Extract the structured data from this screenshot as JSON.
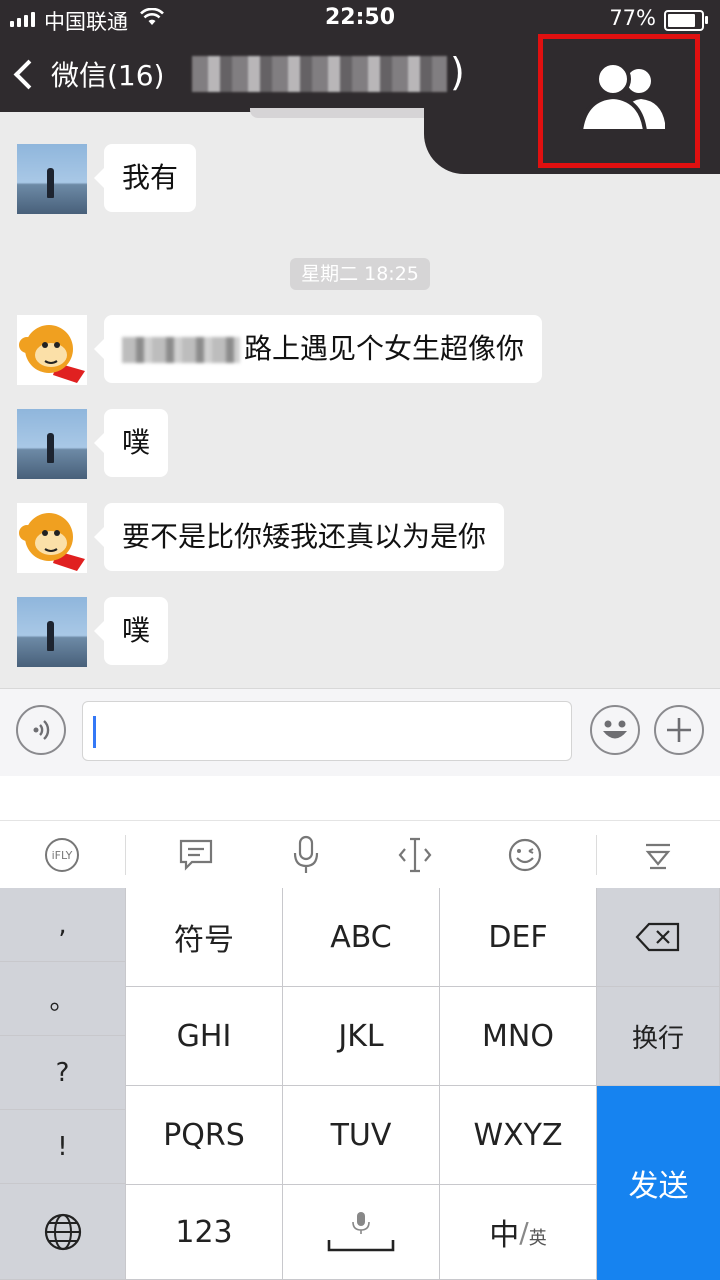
{
  "status_bar": {
    "carrier": "中国联通",
    "time": "22:50",
    "battery_text": "77%",
    "battery_level": 0.77
  },
  "nav": {
    "back_label": "微信(16)",
    "title_suffix": ")",
    "group_icon": "people-icon"
  },
  "chat": {
    "messages": [
      {
        "sender": "self",
        "avatar": "sea-girl",
        "text": "我有"
      },
      {
        "sender": "other",
        "avatar": "monkey",
        "text": "路上遇见个女生超像你"
      },
      {
        "sender": "self",
        "avatar": "sea-girl",
        "text": "噗"
      },
      {
        "sender": "other",
        "avatar": "monkey",
        "text": "要不是比你矮我还真以为是你"
      },
      {
        "sender": "self",
        "avatar": "sea-girl",
        "text": "噗"
      }
    ],
    "timestamp": "星期二 18:25"
  },
  "input": {
    "value": "",
    "voice_icon": "voice-icon",
    "emoji_icon": "emoji-icon",
    "plus_icon": "plus-icon"
  },
  "keyboard_toolbar": [
    "iFLY",
    "comment-icon",
    "mic-icon",
    "cursor-icon",
    "smile-icon",
    "collapse-icon"
  ],
  "ifly_label": "iFLY",
  "keyboard": {
    "side": [
      ",",
      "。",
      "?",
      "!"
    ],
    "grid": [
      [
        "符号",
        "ABC",
        "DEF"
      ],
      [
        "GHI",
        "JKL",
        "MNO"
      ],
      [
        "PQRS",
        "TUV",
        "WXYZ"
      ],
      [
        "123",
        "",
        "中/英"
      ]
    ],
    "zh": "中",
    "en": "英",
    "enter": "换行",
    "send": "发送",
    "send_color": "#1683f0"
  }
}
